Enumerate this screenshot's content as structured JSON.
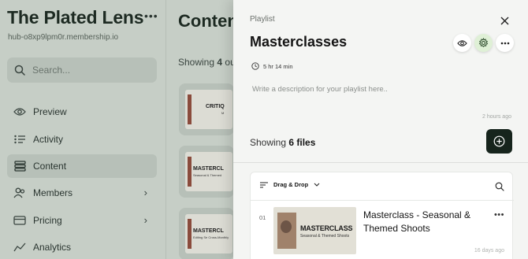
{
  "app": {
    "brand_title": "The Plated Lens",
    "brand_url": "hub-o8xp9lpm0r.membership.io",
    "search_placeholder": "Search..."
  },
  "sidebar": {
    "items": [
      {
        "label": "Preview",
        "icon": "eye-icon"
      },
      {
        "label": "Activity",
        "icon": "list-icon"
      },
      {
        "label": "Content",
        "icon": "stack-icon",
        "active": true
      },
      {
        "label": "Members",
        "icon": "users-icon",
        "chevron": true
      },
      {
        "label": "Pricing",
        "icon": "card-icon",
        "chevron": true
      },
      {
        "label": "Analytics",
        "icon": "chart-icon"
      }
    ]
  },
  "main": {
    "title": "Conten",
    "count_prefix": "Showing",
    "count_value": "4",
    "count_suffix": "ou",
    "thumbs": [
      {
        "text": "CRITIQ",
        "sub": "M"
      },
      {
        "text": "MASTERCL",
        "sub": "Seasonal & Themed"
      },
      {
        "text": "MASTERCL",
        "sub": "Editing Se Cross-Monthly"
      }
    ]
  },
  "panel": {
    "kicker": "Playlist",
    "title": "Masterclasses",
    "duration": "5 hr 14 min",
    "description_placeholder": "Write a description for your playlist here..",
    "updated": "2 hours ago",
    "showing_prefix": "Showing",
    "showing_count": "6 files",
    "sort_label": "Drag & Drop",
    "accent_color": "#16241c",
    "settings_bg": "#dff0d6",
    "files": [
      {
        "index": "01",
        "title": "Masterclass - Seasonal & Themed Shoots",
        "thumb_title": "MASTERCLASS",
        "thumb_subtitle": "Seasonal & Themed Shoots",
        "date": "16 days ago"
      }
    ]
  }
}
